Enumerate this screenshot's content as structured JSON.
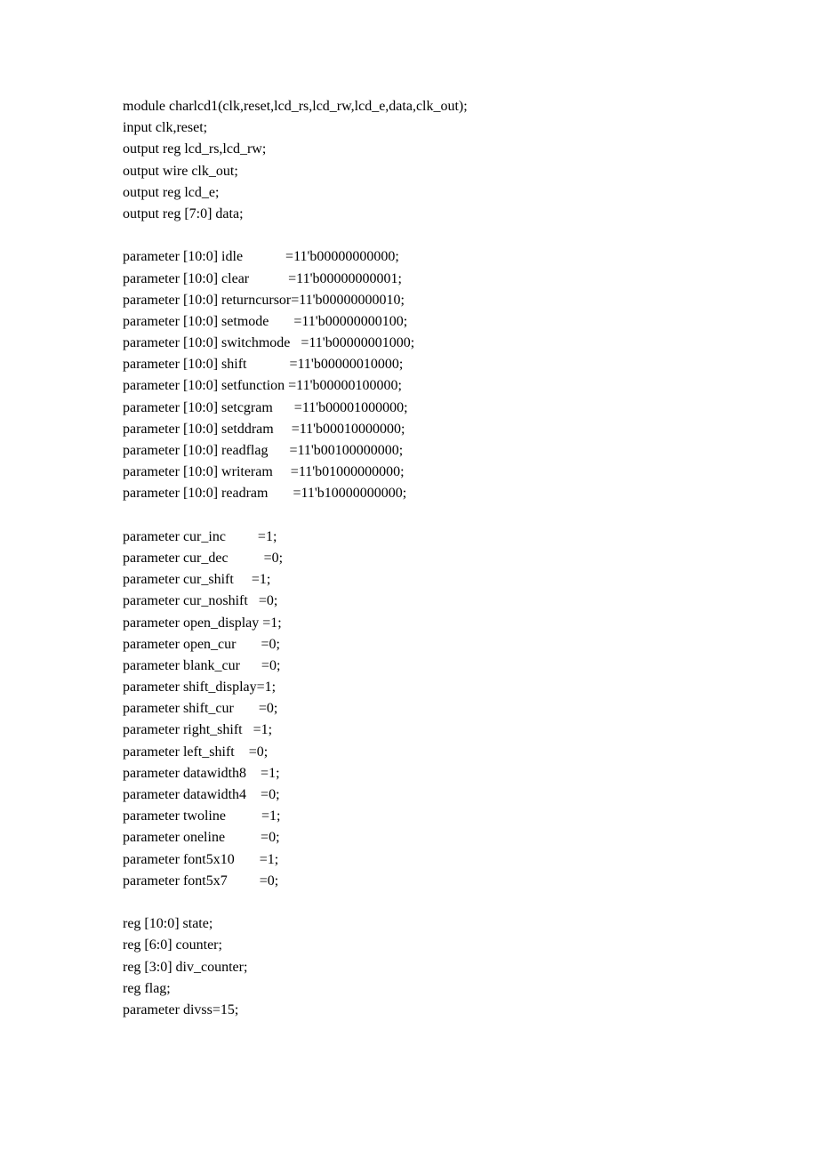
{
  "document": {
    "page_background": "#ffffff",
    "text_color": "#000000",
    "language": "Verilog",
    "module_name": "charlcd1",
    "blocks": [
      {
        "name": "module-declaration-block",
        "lines": [
          "module charlcd1(clk,reset,lcd_rs,lcd_rw,lcd_e,data,clk_out);",
          "input clk,reset;",
          "output reg lcd_rs,lcd_rw;",
          "output wire clk_out;",
          "output reg lcd_e;",
          "output reg [7:0] data;"
        ]
      },
      {
        "name": "state-parameter-block",
        "lines": [
          "parameter [10:0] idle            =11'b00000000000;",
          "parameter [10:0] clear           =11'b00000000001;",
          "parameter [10:0] returncursor=11'b00000000010;",
          "parameter [10:0] setmode       =11'b00000000100;",
          "parameter [10:0] switchmode   =11'b00000001000;",
          "parameter [10:0] shift            =11'b00000010000;",
          "parameter [10:0] setfunction =11'b00000100000;",
          "parameter [10:0] setcgram      =11'b00001000000;",
          "parameter [10:0] setddram     =11'b00010000000;",
          "parameter [10:0] readflag      =11'b00100000000;",
          "parameter [10:0] writeram     =11'b01000000000;",
          "parameter [10:0] readram       =11'b10000000000;"
        ]
      },
      {
        "name": "control-parameter-block",
        "lines": [
          "parameter cur_inc         =1;",
          "parameter cur_dec          =0;",
          "parameter cur_shift     =1;",
          "parameter cur_noshift   =0;",
          "parameter open_display =1;",
          "parameter open_cur       =0;",
          "parameter blank_cur      =0;",
          "parameter shift_display=1;",
          "parameter shift_cur       =0;",
          "parameter right_shift   =1;",
          "parameter left_shift    =0;",
          "parameter datawidth8    =1;",
          "parameter datawidth4    =0;",
          "parameter twoline          =1;",
          "parameter oneline          =0;",
          "parameter font5x10       =1;",
          "parameter font5x7         =0;"
        ]
      },
      {
        "name": "register-declaration-block",
        "lines": [
          "reg [10:0] state;",
          "reg [6:0] counter;",
          "reg [3:0] div_counter;",
          "reg flag;",
          "parameter divss=15;"
        ]
      }
    ]
  }
}
